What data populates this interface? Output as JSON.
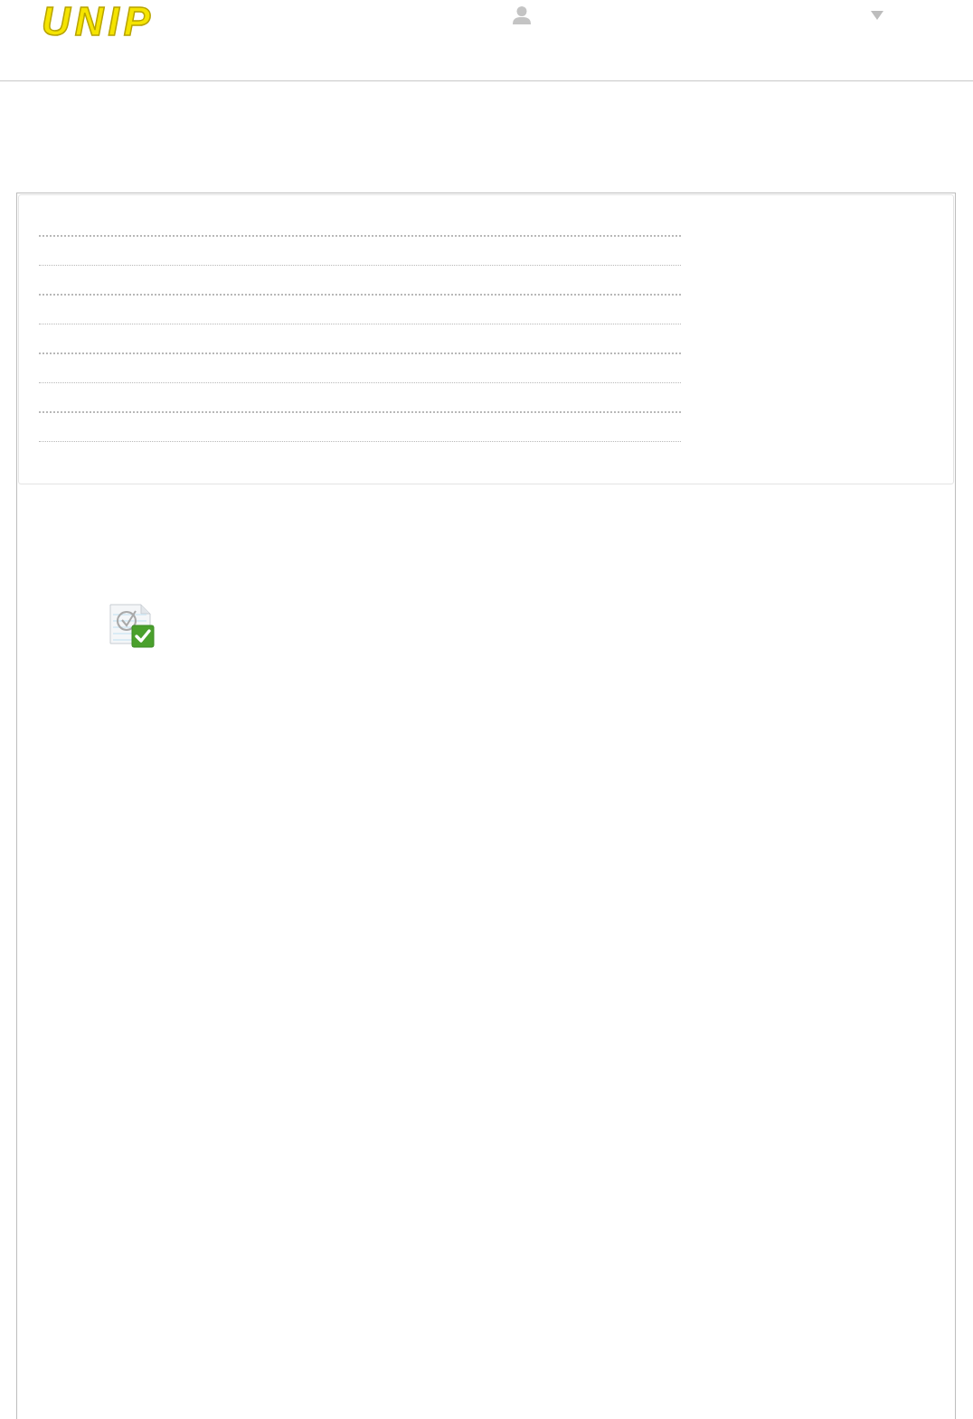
{
  "header": {
    "logo": "UNIP"
  }
}
